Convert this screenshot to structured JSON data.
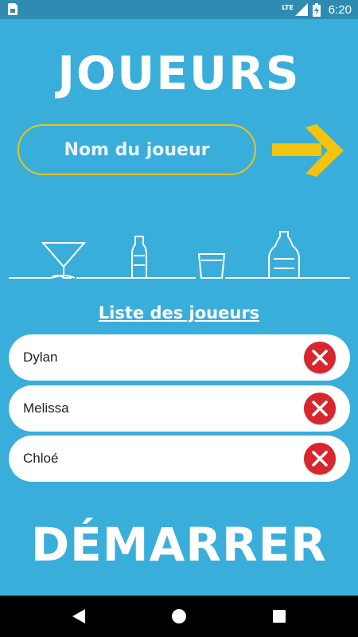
{
  "status_bar": {
    "network": "LTE",
    "time": "6:20",
    "icons": [
      "sim-card-icon",
      "signal-icon",
      "battery-charging-icon"
    ]
  },
  "header": {
    "title": "JOUEURS"
  },
  "player_input": {
    "placeholder": "Nom du joueur",
    "value": "",
    "submit_icon": "arrow-right-icon",
    "accent_color": "#e8c515"
  },
  "players": {
    "heading": "Liste des joueurs",
    "items": [
      {
        "name": "Dylan"
      },
      {
        "name": "Melissa"
      },
      {
        "name": "Chloé"
      }
    ],
    "remove_icon": "close-circle-icon",
    "remove_color": "#d8262e"
  },
  "actions": {
    "start_label": "DÉMARRER"
  },
  "theme": {
    "background": "#3aaedb",
    "status_bar": "#2e8cb3"
  },
  "nav_bar": {
    "buttons": [
      "back-icon",
      "home-icon",
      "recents-icon"
    ]
  }
}
